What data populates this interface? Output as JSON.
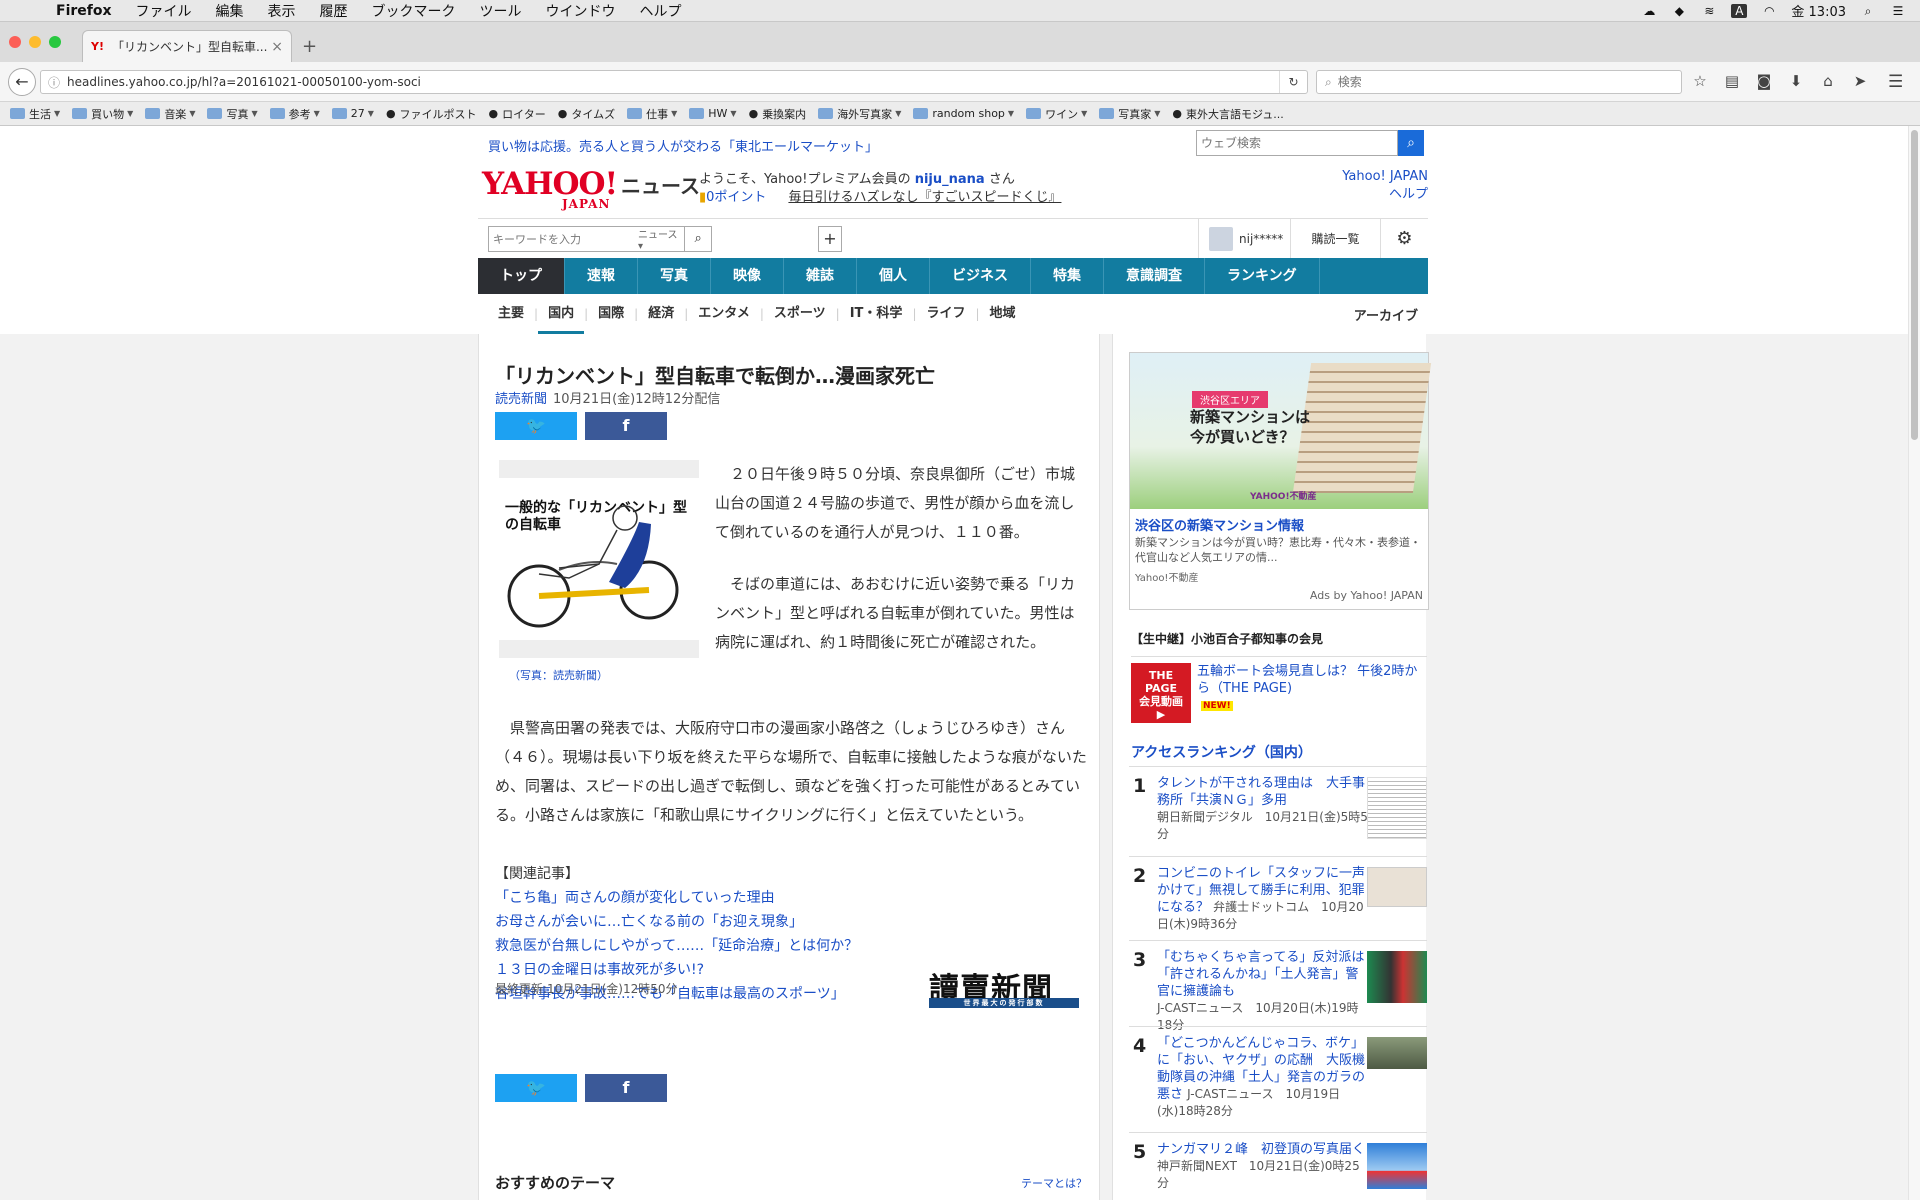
{
  "menubar": {
    "app": "Firefox",
    "items": [
      "ファイル",
      "編集",
      "表示",
      "履歴",
      "ブックマーク",
      "ツール",
      "ウインドウ",
      "ヘルプ"
    ],
    "input_indicator": "A",
    "clock": "金 13:03"
  },
  "tab": {
    "title": "「リカンベント」型自転車...",
    "favicon": "Y!"
  },
  "urlbar": {
    "url": "headlines.yahoo.co.jp/hl?a=20161021-00050100-yom-soci"
  },
  "searchbar": {
    "placeholder": "検索"
  },
  "bookmarks": [
    {
      "label": "生活",
      "kind": "folder"
    },
    {
      "label": "買い物",
      "kind": "folder"
    },
    {
      "label": "音楽",
      "kind": "folder"
    },
    {
      "label": "写真",
      "kind": "folder"
    },
    {
      "label": "参考",
      "kind": "folder"
    },
    {
      "label": "27",
      "kind": "folder"
    },
    {
      "label": "ファイルポスト",
      "kind": "link"
    },
    {
      "label": "ロイター",
      "kind": "link"
    },
    {
      "label": "タイムズ",
      "kind": "link"
    },
    {
      "label": "仕事",
      "kind": "folder"
    },
    {
      "label": "HW",
      "kind": "folder"
    },
    {
      "label": "乗換案内",
      "kind": "link"
    },
    {
      "label": "海外写真家",
      "kind": "folder"
    },
    {
      "label": "random shop",
      "kind": "folder"
    },
    {
      "label": "ワイン",
      "kind": "folder"
    },
    {
      "label": "写真家",
      "kind": "folder"
    },
    {
      "label": "東外大言語モジュ...",
      "kind": "link"
    }
  ],
  "site": {
    "promo": "買い物は応援。売る人と買う人が交わる「東北エールマーケット」",
    "websearch_placeholder": "ウェブ検索",
    "logo": "YAHOO!",
    "logo_sub": "JAPAN",
    "logo_news": "ニュース",
    "welcome_pre": "ようこそ、Yahoo!プレミアム会員の ",
    "welcome_user": "niju_nana",
    "welcome_post": " さん",
    "points": "0ポイント",
    "lottery": "毎日引けるハズレなし『すごいスピードくじ』",
    "yahoo_japan": "Yahoo! JAPAN",
    "help": "ヘルプ",
    "keyword_placeholder": "キーワードを入力",
    "search_category": "ニュース",
    "user_name": "nij*****",
    "subscriptions": "購読一覧"
  },
  "mainnav": [
    "トップ",
    "速報",
    "写真",
    "映像",
    "雑誌",
    "個人",
    "ビジネス",
    "特集",
    "意識調査",
    "ランキング"
  ],
  "subnav": [
    "主要",
    "国内",
    "国際",
    "経済",
    "エンタメ",
    "スポーツ",
    "IT・科学",
    "ライフ",
    "地域"
  ],
  "archive": "アーカイブ",
  "article": {
    "headline": "「リカンベント」型自転車で転倒か…漫画家死亡",
    "source": "読売新聞",
    "date": "10月21日(金)12時12分配信",
    "photo_title": "一般的な「リカンベント」型の自転車",
    "photo_caption": "（写真：読売新聞）",
    "p1": "２０日午後９時５０分頃、奈良県御所（ごせ）市城山台の国道２４号脇の歩道で、男性が顔から血を流して倒れているのを通行人が見つけ、１１０番。",
    "p2": "そばの車道には、あおむけに近い姿勢で乗る「リカンベント」型と呼ばれる自転車が倒れていた。男性は病院に運ばれ、約１時間後に死亡が確認された。",
    "p3": "県警高田署の発表では、大阪府守口市の漫画家小路啓之（しょうじひろゆき）さん（４６）。現場は長い下り坂を終えた平らな場所で、自転車に接触したような痕がないため、同署は、スピードの出し過ぎで転倒し、頭などを強く打った可能性があるとみている。小路さんは家族に「和歌山県にサイクリングに行く」と伝えていたという。",
    "related_heading": "【関連記事】",
    "related": [
      "「こち亀」両さんの顔が変化していった理由",
      "お母さんが会いに…亡くなる前の「お迎え現象」",
      "救急医が台無しにしやがって……「延命治療」とは何か？",
      "１３日の金曜日は事故死が多い!?",
      "谷垣幹事長が事故……でも「自転車は最高のスポーツ」"
    ],
    "updated": "最終更新:10月21日(金)12時50分",
    "publisher_logo": "讀賣新聞",
    "publisher_strip": "世界最大の発行部数",
    "themes_title": "おすすめのテーマ",
    "themes_link": "テーマとは？"
  },
  "sidebar": {
    "ad": {
      "badge": "渋谷区エリア",
      "copy1": "新築マンションは",
      "copy2": "今が買いどき？",
      "brand": "YAHOO!不動産",
      "title": "渋谷区の新築マンション情報",
      "desc": "新築マンションは今が買い時？恵比寿・代々木・表参道・代官山など人気エリアの情...",
      "source": "Yahoo!不動産",
      "adsby": "Ads by Yahoo! JAPAN"
    },
    "live_heading": "【生中継】小池百合子都知事の会見",
    "live": {
      "thumb_line1": "THE PAGE",
      "thumb_line2": "会見動画",
      "text": "五輪ボート会場見直しは？ 午後2時から（THE PAGE)",
      "new": "NEW!"
    },
    "ranking_heading": "アクセスランキング（国内）",
    "ranking": [
      {
        "num": "1",
        "title": "タレントが干される理由は　大手事務所「共演ＮＧ」多用",
        "meta": "朝日新聞デジタル　10月21日(金)5時5分"
      },
      {
        "num": "2",
        "title": "コンビニのトイレ「スタッフに一声かけて」無視して勝手に利用、犯罪になる？",
        "meta": "弁護士ドットコム　10月20日(木)9時36分"
      },
      {
        "num": "3",
        "title": "「むちゃくちゃ言ってる」反対派は「許されるんかね」「土人発言」警官に擁護論も",
        "meta": "J-CASTニュース　10月20日(木)19時18分"
      },
      {
        "num": "4",
        "title": "「どこつかんどんじゃコラ、ボケ」に「おい、ヤクザ」の応酬　大阪機動隊員の沖縄「土人」発言のガラの悪さ",
        "meta": "J-CASTニュース　10月19日(水)18時28分"
      },
      {
        "num": "5",
        "title": "ナンガマリ２峰　初登頂の写真届く",
        "meta": "神戸新聞NEXT　10月21日(金)0時25分"
      }
    ]
  },
  "colors": {
    "nav_bg": "#127ca0",
    "nav_active": "#2c2e33",
    "link": "#1a4ec6",
    "yahoo_red": "#e00024",
    "twitter": "#1da1f2",
    "facebook": "#3b5998"
  },
  "icons": [
    "apple-icon",
    "back-arrow-icon",
    "info-icon",
    "reload-icon",
    "search-icon",
    "star-icon",
    "reading-list-icon",
    "pocket-icon",
    "download-icon",
    "home-icon",
    "send-icon",
    "hamburger-icon",
    "gear-icon",
    "twitter-icon",
    "facebook-icon"
  ]
}
